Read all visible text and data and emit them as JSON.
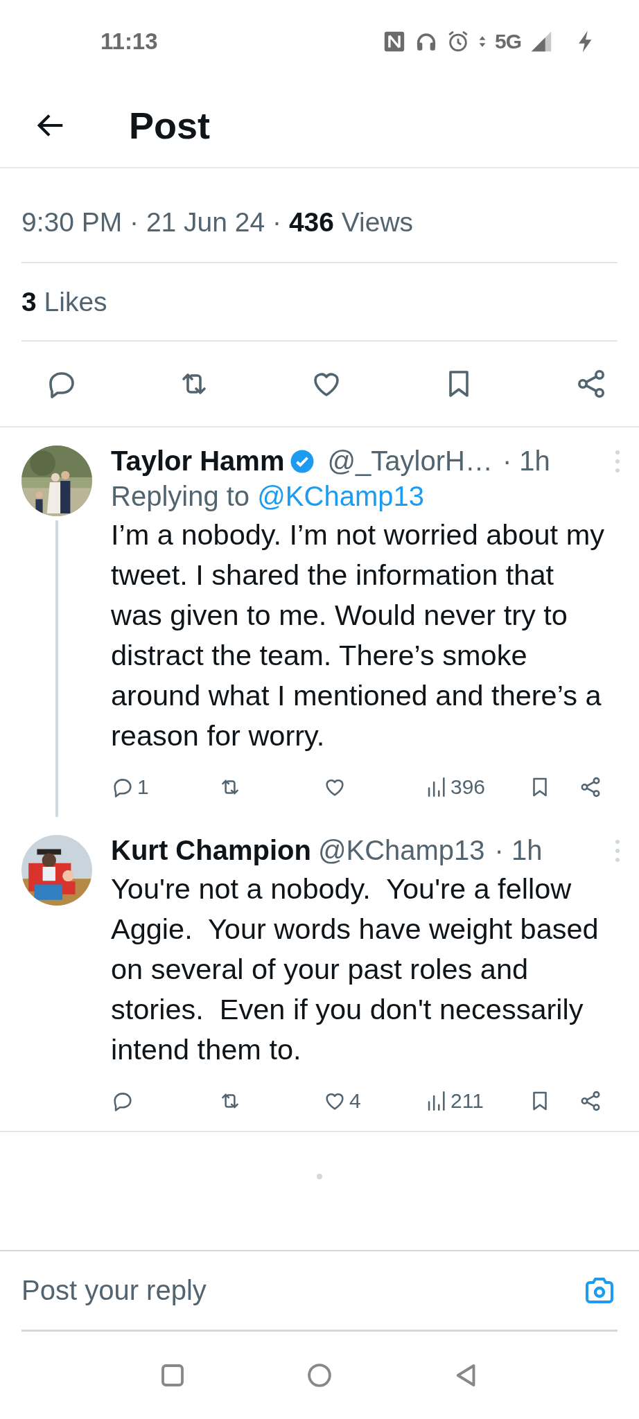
{
  "status_bar": {
    "time": "11:13",
    "network": "5G"
  },
  "header": {
    "title": "Post"
  },
  "post": {
    "meta": "9:30 PM · 21 Jun 24 · **436** Views",
    "likes": "**3** Likes",
    "actions": [
      {
        "kind": "reply"
      },
      {
        "kind": "repost"
      },
      {
        "kind": "like"
      },
      {
        "kind": "bookmark"
      },
      {
        "kind": "share"
      }
    ]
  },
  "replies": [
    {
      "name": "Taylor Hamm",
      "verified": true,
      "handle": "@_TaylorH…",
      "time": "· 1h",
      "replying_to_label": "Replying to",
      "replying_to": "@KChamp13",
      "text": "I’m a nobody. I’m not worried about my tweet. I shared the information that was given to me. Would never try to distract the team. There’s smoke around what I mentioned and there’s a reason for worry.",
      "thread_line": true,
      "actions": [
        {
          "kind": "reply",
          "count": "1"
        },
        {
          "kind": "repost"
        },
        {
          "kind": "like"
        },
        {
          "kind": "views",
          "count": "396"
        },
        {
          "kind": "bookmark"
        },
        {
          "kind": "share"
        }
      ]
    },
    {
      "name": "Kurt Champion",
      "verified": false,
      "handle": "@KChamp13",
      "time": "· 1h",
      "text": "You're not a nobody.  You're a fellow Aggie.  Your words have weight based on several of your past roles and stories.  Even if you don't necessarily intend them to.",
      "thread_line": false,
      "actions": [
        {
          "kind": "reply"
        },
        {
          "kind": "repost"
        },
        {
          "kind": "like",
          "count": "4"
        },
        {
          "kind": "views",
          "count": "211"
        },
        {
          "kind": "bookmark"
        },
        {
          "kind": "share"
        }
      ]
    }
  ],
  "reply_bar": {
    "placeholder": "Post your reply"
  }
}
